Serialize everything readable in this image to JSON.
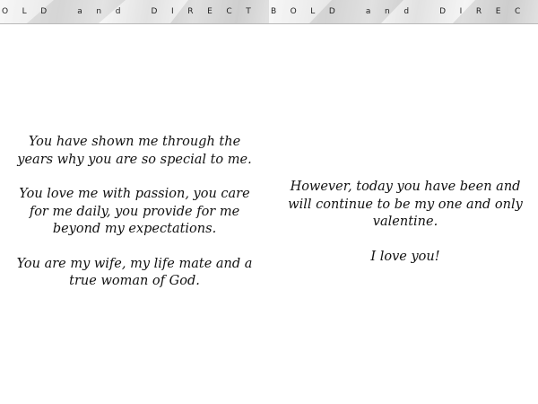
{
  "banner": {
    "left_text": "OLD and DIRECT",
    "right_text": "BOLD and DIREC"
  },
  "left_panel": {
    "paragraphs": [
      "You have shown me through the years why you are so special to me.",
      "You love me with passion, you care for me daily, you provide for me beyond my expectations.",
      "You are my wife, my life mate and a true woman of God."
    ]
  },
  "right_panel": {
    "paragraphs": [
      "However, today you have been and will continue to be my one and only valentine.",
      "I love you!"
    ]
  }
}
